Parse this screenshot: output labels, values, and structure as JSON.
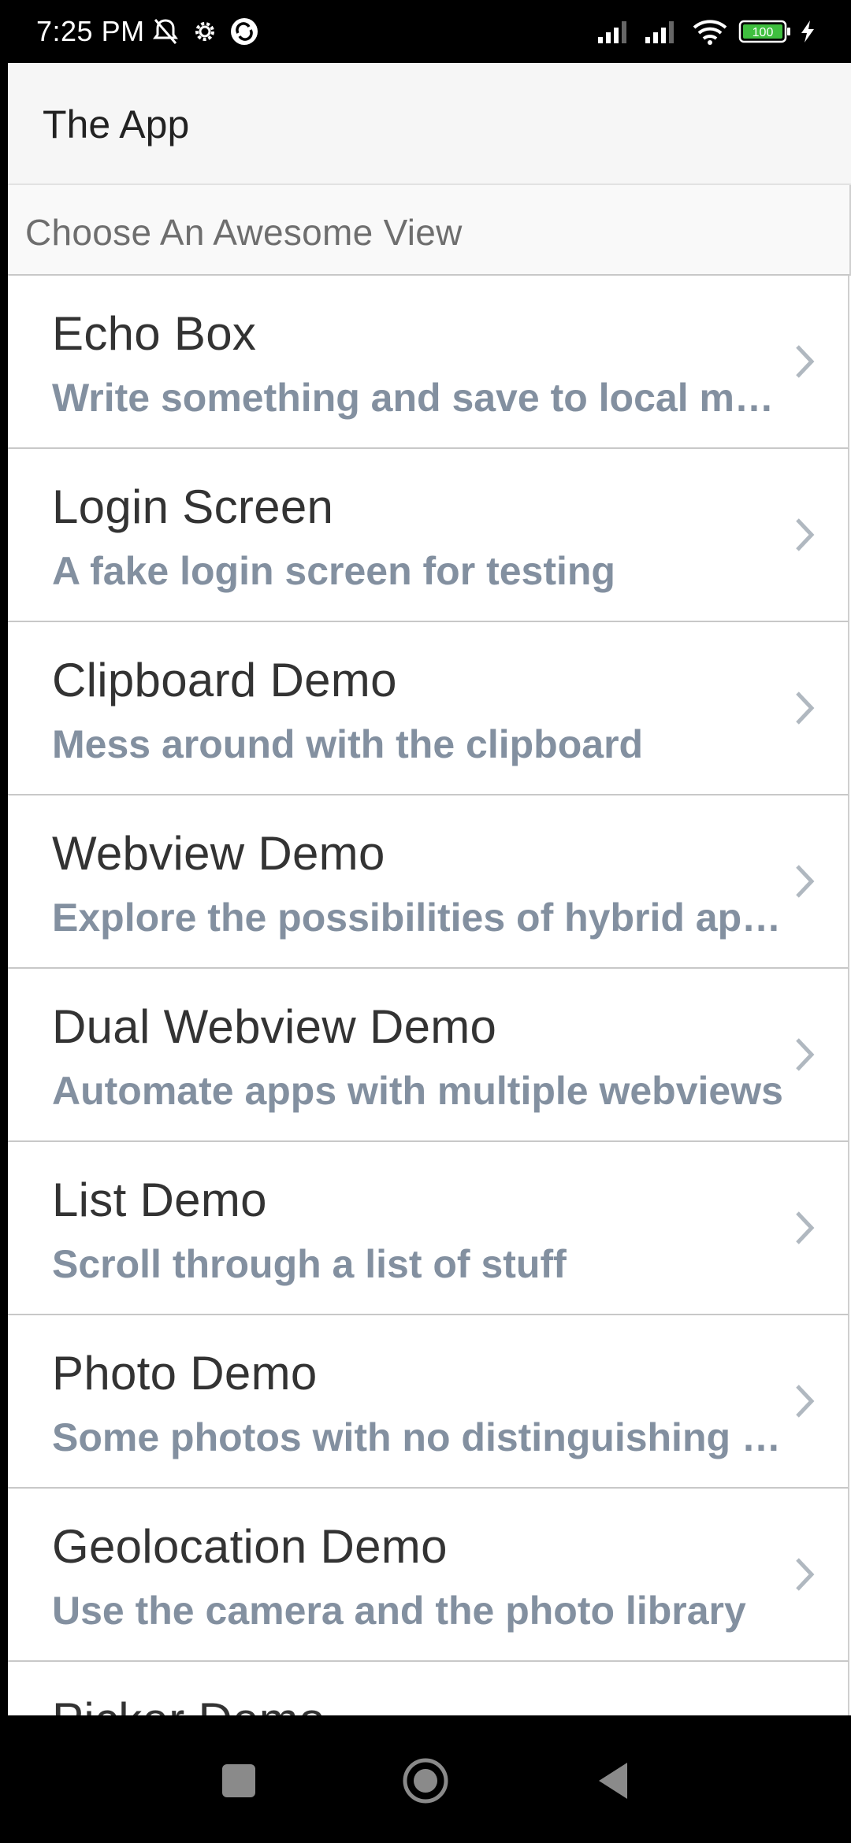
{
  "status_bar": {
    "time": "7:25 PM",
    "battery": "100",
    "icons": [
      "mute-icon",
      "settings-gear-icon",
      "sync-icon",
      "signal-icon",
      "signal-icon",
      "wifi-icon",
      "battery-icon",
      "charging-icon"
    ]
  },
  "header": {
    "title": "The App"
  },
  "section": {
    "title": "Choose An Awesome View"
  },
  "items": [
    {
      "title": "Echo Box",
      "subtitle": "Write something and save to local memory"
    },
    {
      "title": "Login Screen",
      "subtitle": "A fake login screen for testing"
    },
    {
      "title": "Clipboard Demo",
      "subtitle": "Mess around with the clipboard"
    },
    {
      "title": "Webview Demo",
      "subtitle": "Explore the possibilities of hybrid apps"
    },
    {
      "title": "Dual Webview Demo",
      "subtitle": "Automate apps with multiple webviews"
    },
    {
      "title": "List Demo",
      "subtitle": "Scroll through a list of stuff"
    },
    {
      "title": "Photo Demo",
      "subtitle": "Some photos with no distinguishing features"
    },
    {
      "title": "Geolocation Demo",
      "subtitle": "Use the camera and the photo library"
    },
    {
      "title": "Picker Demo",
      "subtitle": ""
    }
  ],
  "colors": {
    "title_text": "#333333",
    "subtitle_text": "#8390a0",
    "header_bg": "#f6f6f6",
    "chevron": "#b0b8c0"
  },
  "nav_bar": {
    "icons": [
      "recents-square-icon",
      "home-circle-icon",
      "back-triangle-icon"
    ]
  }
}
